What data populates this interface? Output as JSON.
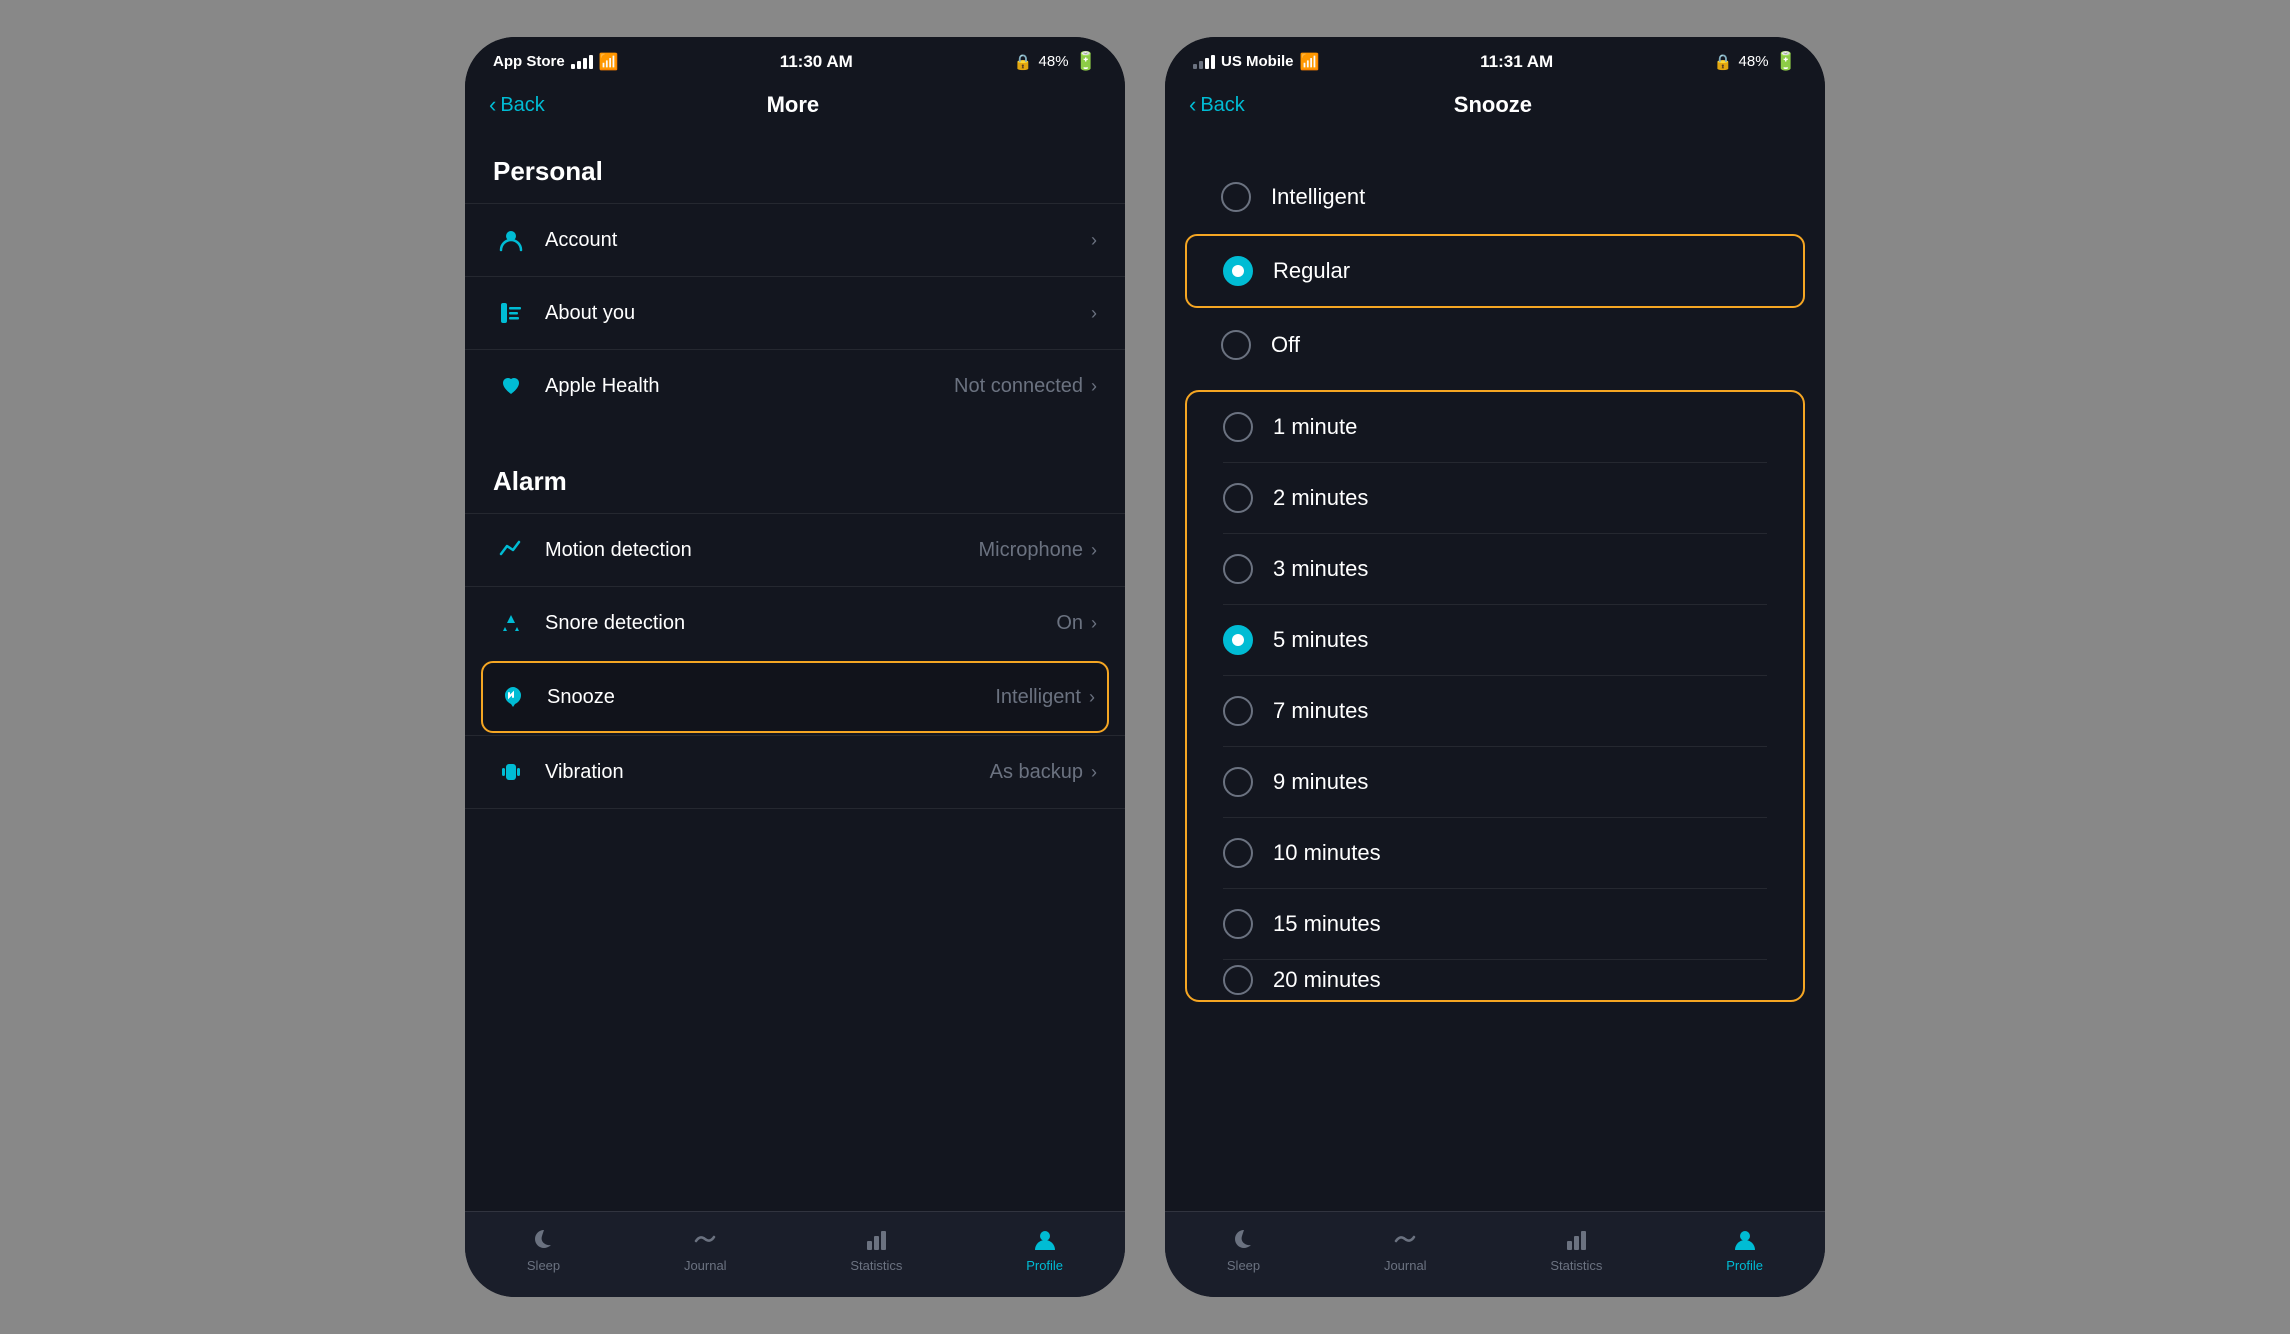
{
  "left_phone": {
    "status_bar": {
      "store": "App Store",
      "signal": "●●●●",
      "wifi": "WiFi",
      "time": "11:30 AM",
      "lock": "🔒",
      "battery": "48%"
    },
    "nav": {
      "back_label": "Back",
      "title": "More"
    },
    "sections": [
      {
        "header": "Personal",
        "items": [
          {
            "id": "account",
            "icon": "person",
            "label": "Account",
            "value": "",
            "highlighted": false
          },
          {
            "id": "about-you",
            "icon": "ruler",
            "label": "About you",
            "value": "",
            "highlighted": false
          },
          {
            "id": "apple-health",
            "icon": "heart",
            "label": "Apple Health",
            "value": "Not connected",
            "highlighted": false
          }
        ]
      },
      {
        "header": "Alarm",
        "items": [
          {
            "id": "motion",
            "icon": "motion",
            "label": "Motion detection",
            "value": "Microphone",
            "highlighted": false
          },
          {
            "id": "snore",
            "icon": "snore",
            "label": "Snore detection",
            "value": "On",
            "highlighted": false
          },
          {
            "id": "snooze",
            "icon": "hand",
            "label": "Snooze",
            "value": "Intelligent",
            "highlighted": true
          },
          {
            "id": "vibration",
            "icon": "vibration",
            "label": "Vibration",
            "value": "As backup",
            "highlighted": false
          }
        ]
      }
    ],
    "tab_bar": {
      "tabs": [
        {
          "id": "sleep",
          "label": "Sleep",
          "icon": "moon",
          "active": false
        },
        {
          "id": "journal",
          "label": "Journal",
          "icon": "journal",
          "active": false
        },
        {
          "id": "statistics",
          "label": "Statistics",
          "icon": "stats",
          "active": false
        },
        {
          "id": "profile",
          "label": "Profile",
          "icon": "person",
          "active": true
        }
      ]
    }
  },
  "right_phone": {
    "status_bar": {
      "carrier": "US Mobile",
      "wifi": "WiFi",
      "time": "11:31 AM",
      "lock": "🔒",
      "battery": "48%"
    },
    "nav": {
      "back_label": "Back",
      "title": "Snooze"
    },
    "top_options": [
      {
        "id": "intelligent",
        "label": "Intelligent",
        "selected": false
      },
      {
        "id": "regular",
        "label": "Regular",
        "selected": true
      },
      {
        "id": "off",
        "label": "Off",
        "selected": false
      }
    ],
    "duration_options": [
      {
        "id": "1min",
        "label": "1 minute",
        "selected": false
      },
      {
        "id": "2min",
        "label": "2 minutes",
        "selected": false
      },
      {
        "id": "3min",
        "label": "3 minutes",
        "selected": false
      },
      {
        "id": "5min",
        "label": "5 minutes",
        "selected": true
      },
      {
        "id": "7min",
        "label": "7 minutes",
        "selected": false
      },
      {
        "id": "9min",
        "label": "9 minutes",
        "selected": false
      },
      {
        "id": "10min",
        "label": "10 minutes",
        "selected": false
      },
      {
        "id": "15min",
        "label": "15 minutes",
        "selected": false
      },
      {
        "id": "20min",
        "label": "20 minutes",
        "selected": false
      }
    ],
    "tab_bar": {
      "tabs": [
        {
          "id": "sleep",
          "label": "Sleep",
          "icon": "moon",
          "active": false
        },
        {
          "id": "journal",
          "label": "Journal",
          "icon": "journal",
          "active": false
        },
        {
          "id": "statistics",
          "label": "Statistics",
          "icon": "stats",
          "active": false
        },
        {
          "id": "profile",
          "label": "Profile",
          "icon": "person",
          "active": true
        }
      ]
    }
  }
}
